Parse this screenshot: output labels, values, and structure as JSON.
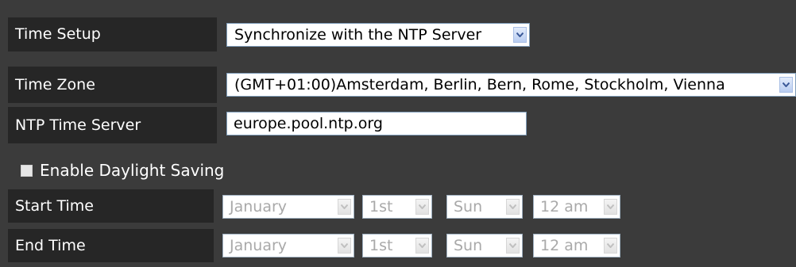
{
  "time_setup": {
    "label": "Time Setup",
    "selected": "Synchronize with the NTP Server"
  },
  "time_zone": {
    "label": "Time Zone",
    "selected": "(GMT+01:00)Amsterdam, Berlin, Bern, Rome, Stockholm, Vienna"
  },
  "ntp_server": {
    "label": "NTP Time Server",
    "value": "europe.pool.ntp.org"
  },
  "daylight_saving": {
    "label": "Enable Daylight Saving",
    "checked": false
  },
  "start_time": {
    "label": "Start Time",
    "month": "January",
    "day": "1st",
    "weekday": "Sun",
    "hour": "12 am"
  },
  "end_time": {
    "label": "End Time",
    "month": "January",
    "day": "1st",
    "weekday": "Sun",
    "hour": "12 am"
  },
  "colors": {
    "panel_bg": "#3b3b3b",
    "label_bg": "#262626",
    "label_text": "#ffffff",
    "disabled_text": "#a9a9a9",
    "dropdown_arrow": "#3b5998"
  },
  "icons": {
    "dropdown": "chevron-down-icon",
    "checkbox": "checkbox-unchecked-icon"
  }
}
